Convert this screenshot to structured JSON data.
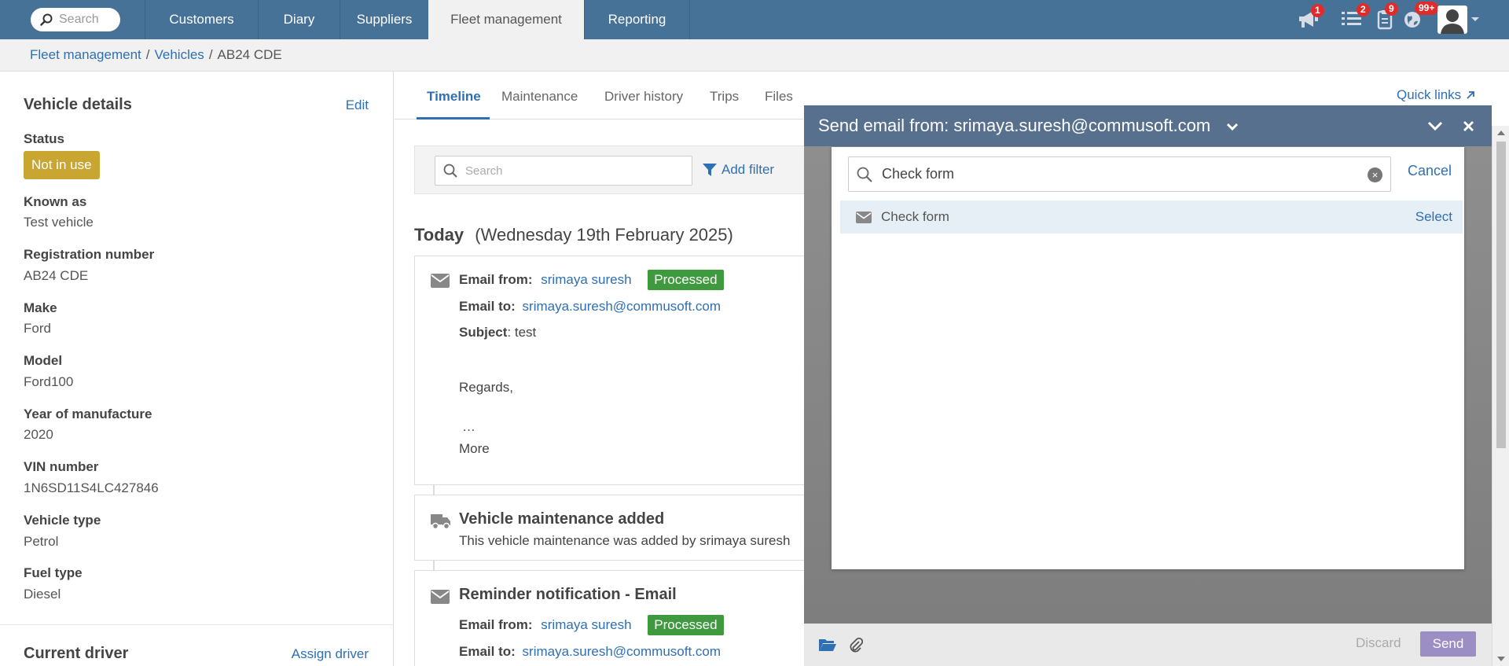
{
  "topbar": {
    "search_label": "Search",
    "nav": [
      "Customers",
      "Diary",
      "Suppliers",
      "Fleet management",
      "Reporting"
    ],
    "badges": {
      "announcements": "1",
      "tasks": "2",
      "clipboard": "9",
      "globe": "99+"
    }
  },
  "breadcrumb": {
    "fleet": "Fleet management",
    "vehicles": "Vehicles",
    "current": "AB24 CDE",
    "sep": "/"
  },
  "vehicle_details": {
    "title": "Vehicle details",
    "edit": "Edit",
    "status_label": "Status",
    "status_value": "Not in use",
    "fields": [
      {
        "label": "Known as",
        "value": "Test vehicle"
      },
      {
        "label": "Registration number",
        "value": "AB24 CDE"
      },
      {
        "label": "Make",
        "value": "Ford"
      },
      {
        "label": "Model",
        "value": "Ford100"
      },
      {
        "label": "Year of manufacture",
        "value": "2020"
      },
      {
        "label": "VIN number",
        "value": "1N6SD11S4LC427846"
      },
      {
        "label": "Vehicle type",
        "value": "Petrol"
      },
      {
        "label": "Fuel type",
        "value": "Diesel"
      }
    ]
  },
  "current_driver": {
    "title": "Current driver",
    "action": "Assign driver"
  },
  "tabs": [
    "Timeline",
    "Maintenance",
    "Driver history",
    "Trips",
    "Files"
  ],
  "quick_links": "Quick links",
  "filter": {
    "placeholder": "Search",
    "add_filter": "Add filter"
  },
  "timeline": {
    "day_label": "Today",
    "day_date": "(Wednesday 19th February 2025)",
    "email_card": {
      "from_label": "Email from:",
      "from_name": "srimaya suresh",
      "status": "Processed",
      "to_label": "Email to:",
      "to_address": "srimaya.suresh@commusoft.com",
      "subject_label": "Subject",
      "subject_value": ": test",
      "regards": "Regards,",
      "ellipsis": "…",
      "more": "More"
    },
    "maintenance_card": {
      "title": "Vehicle maintenance added",
      "text": "This vehicle maintenance was added by srimaya suresh"
    },
    "reminder_card": {
      "title": "Reminder notification - Email",
      "from_label": "Email from:",
      "from_name": "srimaya suresh",
      "status": "Processed",
      "to_label": "Email to:",
      "to_address": "srimaya.suresh@commusoft.com"
    }
  },
  "email_modal": {
    "title": "Send email from: srimaya.suresh@commusoft.com",
    "picker": {
      "search_value": "Check form",
      "cancel": "Cancel",
      "result_name": "Check form",
      "result_action": "Select"
    },
    "footer": {
      "discard": "Discard",
      "send": "Send"
    }
  },
  "colors": {
    "topbar": "#477298",
    "link": "#2f6fb3",
    "status_badge": "#c9a532",
    "processed": "#3f9a3f",
    "modal_header": "#57708d",
    "send_button": "#9b8ec4"
  }
}
